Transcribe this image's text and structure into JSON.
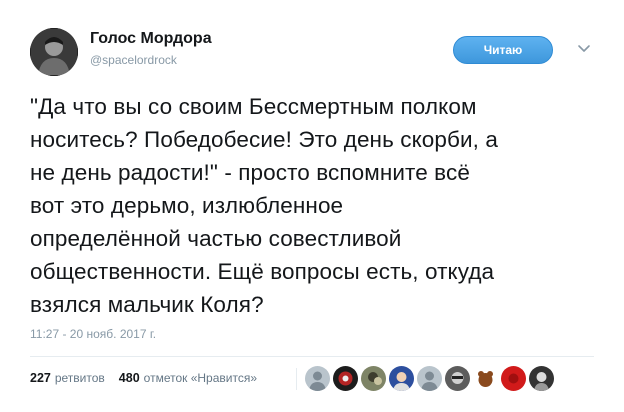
{
  "user": {
    "name": "Голос Мордора",
    "handle": "@spacelordrock"
  },
  "follow_button": {
    "label": "Читаю"
  },
  "tweet": {
    "text": "\"Да что вы со своим Бессмертным полком\nноситесь? Победобесие! Это день скорби, а\nне день радости!\" - просто вспомните всё\nвот это дерьмо, излюбленное\nопределённой частью совестливой\nобщественности. Ещё вопросы есть, откуда\nвзялся мальчик Коля?",
    "timestamp": "11:27 - 20 нояб. 2017 г."
  },
  "stats": {
    "retweets_count": "227",
    "retweets_label": "ретвитов",
    "likes_count": "480",
    "likes_label": "отметок «Нравится»"
  },
  "icons": {
    "avatar": "user-avatar",
    "caret": "chevron-down-icon"
  },
  "colors": {
    "accent": "#3e97dc",
    "muted": "#8899a6",
    "text": "#14171a"
  }
}
